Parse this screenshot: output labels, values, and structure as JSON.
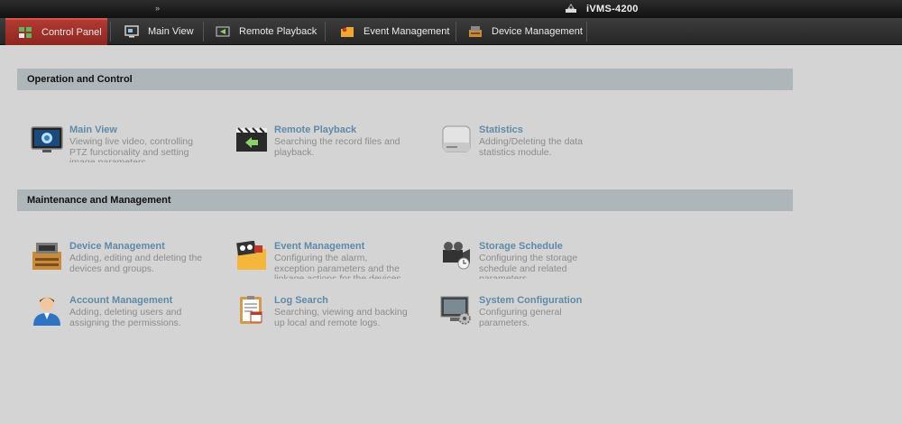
{
  "titlebar": {
    "arrows": "»",
    "app_title": "iVMS-4200"
  },
  "tabs": [
    {
      "label": "Control Panel",
      "icon": "control-panel-icon",
      "active": true
    },
    {
      "label": "Main View",
      "icon": "main-view-icon"
    },
    {
      "label": "Remote Playback",
      "icon": "remote-playback-icon"
    },
    {
      "label": "Event Management",
      "icon": "event-management-icon"
    },
    {
      "label": "Device Management",
      "icon": "device-management-icon"
    }
  ],
  "sections": [
    {
      "title": "Operation and Control",
      "items": [
        {
          "title": "Main View",
          "desc": "Viewing live video, controlling PTZ functionality and setting image parameters.",
          "icon": "main-view-icon"
        },
        {
          "title": "Remote Playback",
          "desc": "Searching the record files and playback.",
          "icon": "remote-playback-icon"
        },
        {
          "title": "Statistics",
          "desc": "Adding/Deleting the data statistics module.",
          "icon": "statistics-icon"
        }
      ]
    },
    {
      "title": "Maintenance and Management",
      "items": [
        {
          "title": "Device Management",
          "desc": "Adding, editing and deleting the devices and groups.",
          "icon": "device-management-icon"
        },
        {
          "title": "Event Management",
          "desc": "Configuring the alarm, exception parameters and the linkage actions for the devices.",
          "icon": "event-management-icon"
        },
        {
          "title": "Storage Schedule",
          "desc": "Configuring the storage schedule and related parameters.",
          "icon": "storage-schedule-icon"
        },
        {
          "title": "Account Management",
          "desc": "Adding, deleting users and assigning the permissions.",
          "icon": "account-management-icon"
        },
        {
          "title": "Log Search",
          "desc": "Searching, viewing and backing up local and remote logs.",
          "icon": "log-search-icon"
        },
        {
          "title": "System Configuration",
          "desc": "Configuring general parameters.",
          "icon": "system-configuration-icon"
        }
      ]
    }
  ],
  "colors": {
    "active_tab": "#a2302a",
    "section_header": "#aeb6ba",
    "item_title": "#5f8aa8",
    "item_desc": "#8c8c8c",
    "background": "#d4d4d4"
  }
}
